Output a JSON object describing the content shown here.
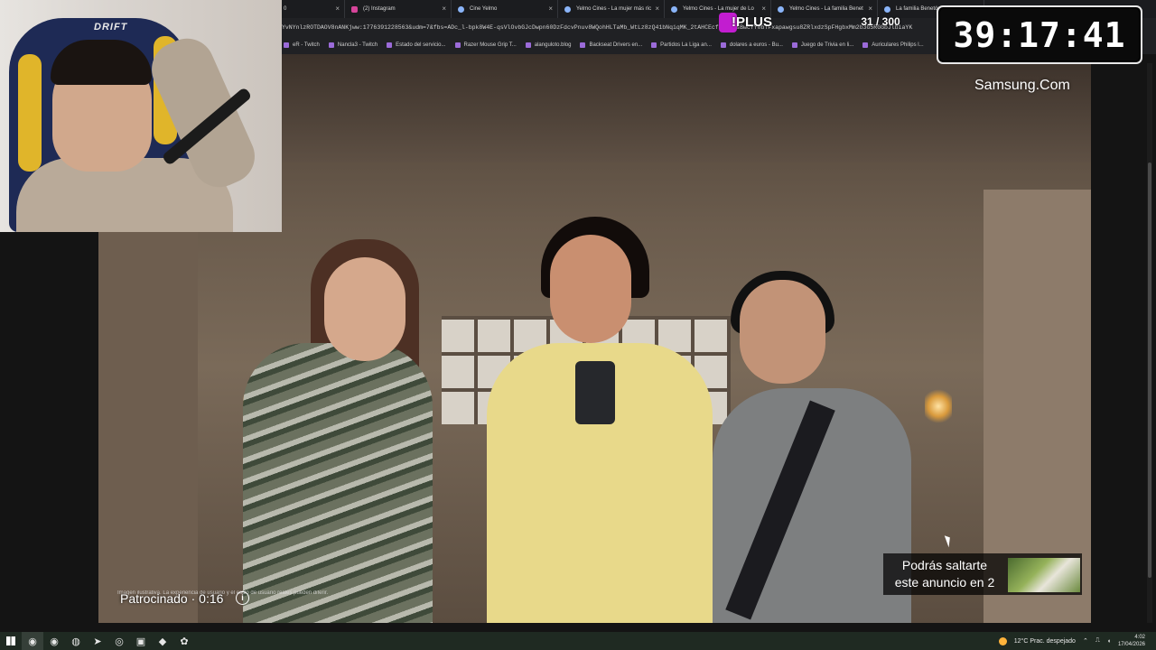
{
  "browser": {
    "tabs": [
      {
        "label": "0"
      },
      {
        "label": "(2) Instagram"
      },
      {
        "label": "Cine Yelmo"
      },
      {
        "label": "Yelmo Cines - La mujer más ric"
      },
      {
        "label": "Yelmo Cines - La mujer de Lo"
      },
      {
        "label": "Yelmo Cines - La familia Benet"
      },
      {
        "label": "La familia Benetón"
      }
    ],
    "url": "YvNYnlzROTDAOV8nANKjww:1776391228563&udm=7&fbs=ADc_l-bpk8W4E-qsVlOvbGJcDwpn60DzFdcvPnuv8WQohHLTaMb_WtLz8zQ41bNqiqMK_2tAHCEcfSm_rtsBwcYY0bTFxapawgsu8ZRlxdzSpFHgbxMm2b3G5RGGbJlbiaYK",
    "bookmarks": [
      "eR - Twitch",
      "Nancla3 - Twitch",
      "Estado del servicio...",
      "Razer Mouse Grip T...",
      "alanguloto.blog",
      "Backseat Drivers en...",
      "Partidos La Liga an...",
      "dolares a euros - Bu...",
      "Juego de Trivia en li...",
      "Auriculares Philips l..."
    ]
  },
  "overlay": {
    "plus_label": "!PLUS",
    "sub_counter": "31 / 300",
    "timer": "39:17:41"
  },
  "webcam": {
    "chair_brand": "DRIFT"
  },
  "video": {
    "brand": "Samsung.Com",
    "sponsored": "Patrocinado · 0:16",
    "info_icon": "i",
    "disclaimer": "Imagen ilustrativa. La experiencia de usuario y el estilo de usuario reales pueden diferir.",
    "skip_text": "Podrás saltarte este anuncio en 2"
  },
  "taskbar": {
    "weather": "12°C  Prac. despejado",
    "time": "4:02",
    "date": "17/04/2026"
  }
}
